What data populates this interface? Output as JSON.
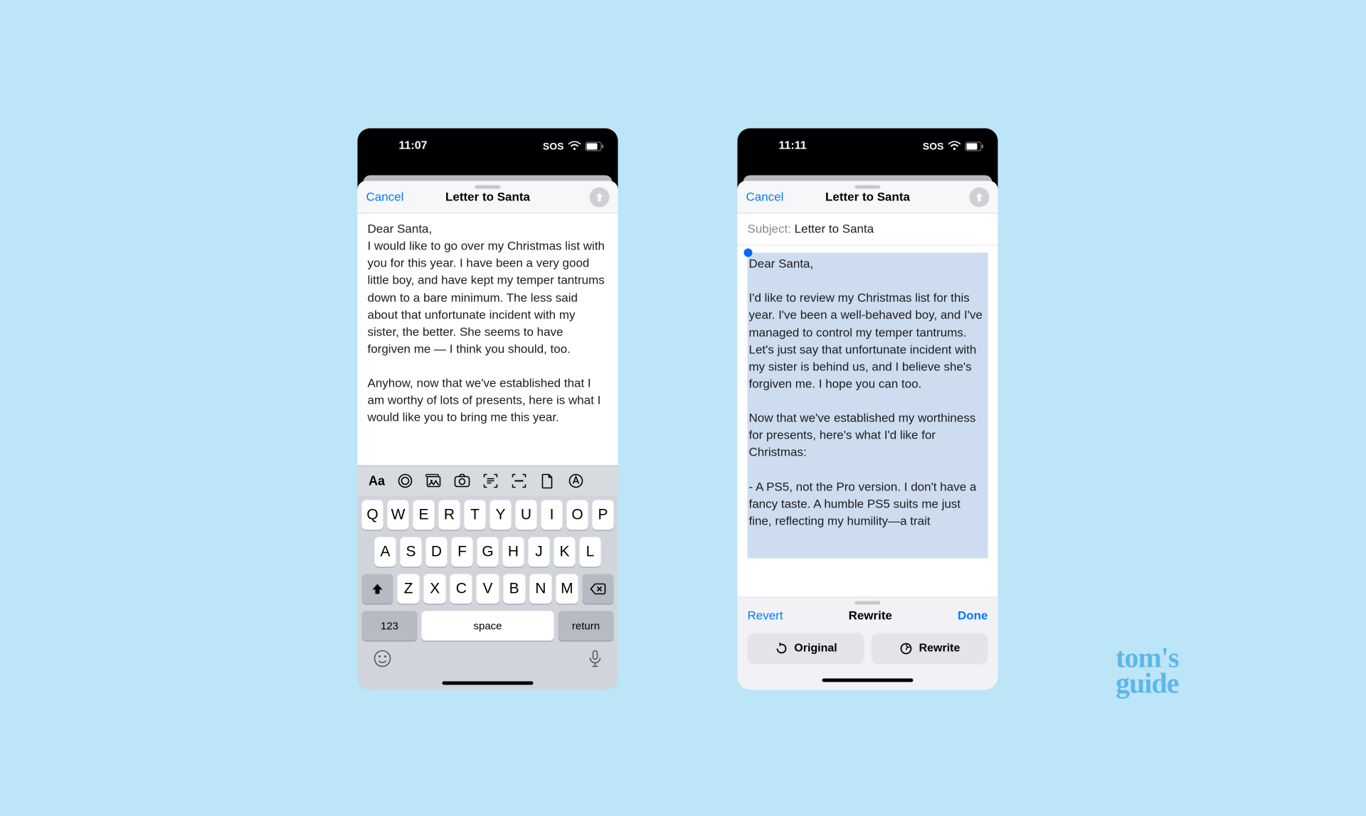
{
  "status": {
    "left_time": "11:07",
    "right_time": "11:11",
    "sos": "SOS"
  },
  "nav": {
    "cancel": "Cancel",
    "title": "Letter to Santa"
  },
  "left_body": "Dear Santa,\nI would like to go over my Christmas list with you for this year. I have been a very good little boy, and have kept my temper tantrums down to a bare minimum. The less said about that unfortunate incident with my sister, the better. She seems to have forgiven me — I think you should, too.\n\nAnyhow, now that we've established that I am worthy of lots of presents, here is what I would like you to bring me this year.",
  "right": {
    "subject_label": "Subject:",
    "subject_value": "Letter to Santa",
    "body": "Dear Santa,\n\nI'd like to review my Christmas list for this year. I've been a well-behaved boy, and I've managed to control my temper tantrums. Let's just say that unfortunate incident with my sister is behind us, and I believe she's forgiven me. I hope you can too.\n\nNow that we've established my worthiness for presents, here's what I'd like for Christmas:\n\n- A PS5, not the Pro version. I don't have a fancy taste. A humble PS5 suits me just fine, reflecting my humility—a trait"
  },
  "keyboard": {
    "row1": [
      "Q",
      "W",
      "E",
      "R",
      "T",
      "Y",
      "U",
      "I",
      "O",
      "P"
    ],
    "row2": [
      "A",
      "S",
      "D",
      "F",
      "G",
      "H",
      "J",
      "K",
      "L"
    ],
    "row3": [
      "Z",
      "X",
      "C",
      "V",
      "B",
      "N",
      "M"
    ],
    "num": "123",
    "space": "space",
    "ret": "return",
    "aa": "Aa"
  },
  "rewrite": {
    "revert": "Revert",
    "title": "Rewrite",
    "done": "Done",
    "original_btn": "Original",
    "rewrite_btn": "Rewrite"
  },
  "watermark": {
    "line1": "tom's",
    "line2": "guide"
  }
}
